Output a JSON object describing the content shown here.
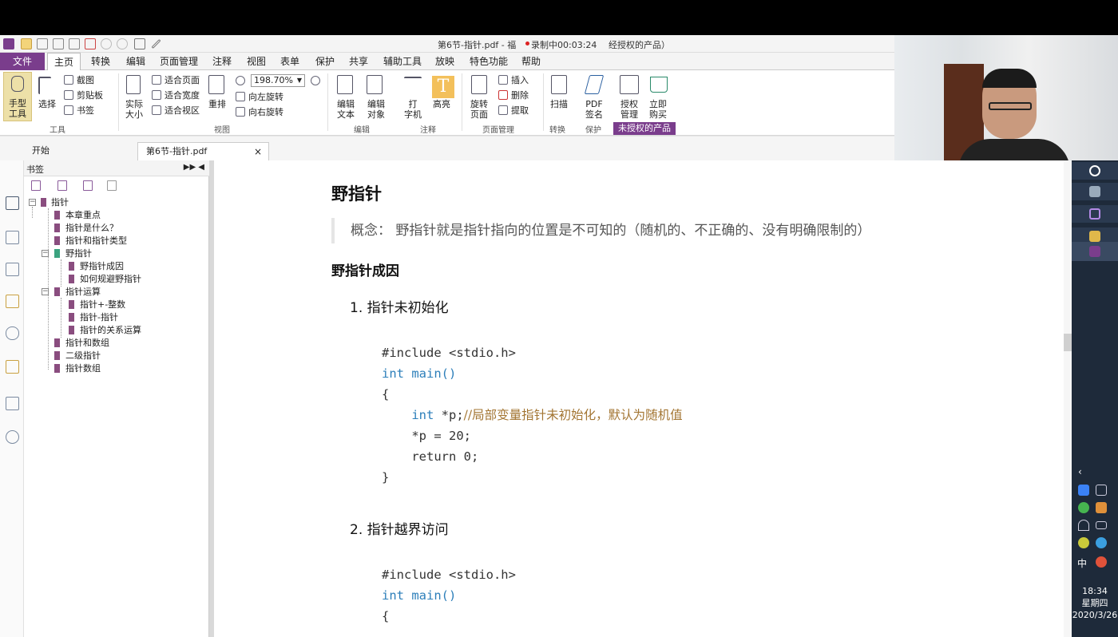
{
  "window": {
    "title": "第6节-指针.pdf - 福",
    "recording": "录制中00:03:24",
    "title_suffix": "经授权的产品）"
  },
  "menu": {
    "file": "文件",
    "items": [
      "主页",
      "转换",
      "编辑",
      "页面管理",
      "注释",
      "视图",
      "表单",
      "保护",
      "共享",
      "辅助工具",
      "放映",
      "特色功能",
      "帮助"
    ]
  },
  "ribbon": {
    "hand_tool": "手型\n工具",
    "select": "选择",
    "snapshot": "截图",
    "clipboard": "剪贴板",
    "bookmark": "书签",
    "tools_group": "工具",
    "actual_size": "实际\n大小",
    "fit_page": "适合页面",
    "fit_width": "适合宽度",
    "fit_visible": "适合视区",
    "reflow": "重排",
    "zoom": "198.70%",
    "rotate_left": "向左旋转",
    "rotate_right": "向右旋转",
    "view_group": "视图",
    "edit_text": "编辑\n文本",
    "edit_object": "编辑\n对象",
    "edit_group": "编辑",
    "typewriter": "打\n字机",
    "highlight": "高亮",
    "annot_group": "注释",
    "rotate_page": "旋转\n页面",
    "insert": "插入",
    "delete": "删除",
    "extract": "提取",
    "page_group": "页面管理",
    "scan": "扫描",
    "convert_group": "转换",
    "pdf_sign": "PDF\n签名",
    "protect_group": "保护",
    "license_mgmt": "授权\n管理",
    "buy_now": "立即\n购买",
    "unlicensed": "未授权的产品"
  },
  "tabs": {
    "start": "开始",
    "file": "第6节-指针.pdf",
    "close": "×"
  },
  "bookmarks": {
    "title": "书签",
    "controls": "▶▶ ◀",
    "items": [
      {
        "label": "指针",
        "level": 0
      },
      {
        "label": "本章重点",
        "level": 1
      },
      {
        "label": "指针是什么？",
        "level": 1
      },
      {
        "label": "指针和指针类型",
        "level": 1
      },
      {
        "label": "野指针",
        "level": 1
      },
      {
        "label": "野指针成因",
        "level": 2
      },
      {
        "label": "如何规避野指针",
        "level": 2
      },
      {
        "label": "指针运算",
        "level": 1
      },
      {
        "label": "指针+-整数",
        "level": 2
      },
      {
        "label": "指针-指针",
        "level": 2
      },
      {
        "label": "指针的关系运算",
        "level": 2
      },
      {
        "label": "指针和数组",
        "level": 1
      },
      {
        "label": "二级指针",
        "level": 1
      },
      {
        "label": "指针数组",
        "level": 1
      }
    ]
  },
  "document": {
    "h1": "野指针",
    "concept": "概念： 野指针就是指针指向的位置是不可知的（随机的、不正确的、没有明确限制的）",
    "h2": "野指针成因",
    "item1": "1. 指针未初始化",
    "item2": "2. 指针越界访问",
    "code1": {
      "include": "#include <stdio.h>",
      "int_kw": "int",
      "main": " main()",
      "open": "{",
      "l1_kw": "int",
      "l1_code": " *p;",
      "l1_comment": "//局部变量指针未初始化，默认为随机值",
      "l2": "*p = 20;",
      "l3": "return 0;",
      "close": "}"
    },
    "code2": {
      "include": "#include <stdio.h>",
      "int_kw": "int",
      "main": " main()",
      "open": "{"
    }
  },
  "taskbar": {
    "ime": "中",
    "time": "18:34",
    "weekday": "星期四",
    "date": "2020/3/26"
  }
}
